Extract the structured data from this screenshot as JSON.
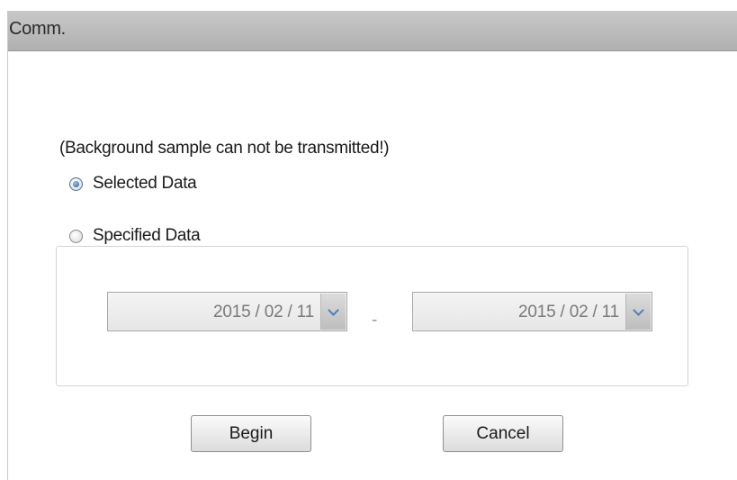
{
  "window": {
    "title": "Comm."
  },
  "notice": "(Background sample can not be transmitted!)",
  "options": [
    {
      "label": "Selected Data",
      "checked": true
    },
    {
      "label": "Specified Data",
      "checked": false
    }
  ],
  "date_range": {
    "start": "2015 / 02 / 11",
    "end": "2015 / 02 / 11",
    "separator": "-"
  },
  "buttons": {
    "begin": "Begin",
    "cancel": "Cancel"
  },
  "icons": {
    "dropdown": "chevron-down-icon"
  },
  "colors": {
    "titlebar": "#b8b8b8",
    "radio_selected": "#2b5a92",
    "chevron": "#4f7fb4"
  }
}
